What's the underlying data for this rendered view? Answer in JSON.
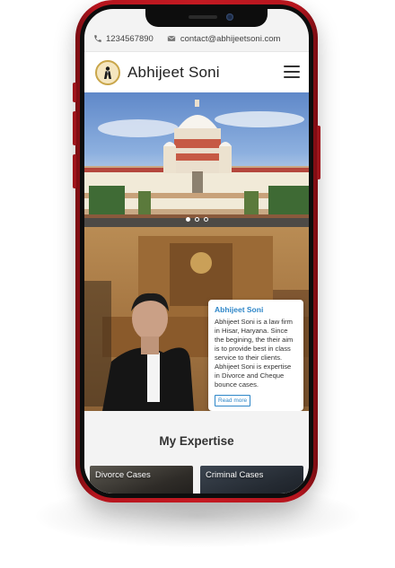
{
  "topbar": {
    "phone_icon": "phone-icon",
    "phone": "1234567890",
    "mail_icon": "envelope-icon",
    "email": "contact@abhijeetsoni.com"
  },
  "header": {
    "logo_icon": "lawyer-logo-icon",
    "brand": "Abhijeet Soni",
    "menu_icon": "hamburger-menu-icon"
  },
  "hero": {
    "slide_count": 3,
    "active_slide": 1
  },
  "about": {
    "title": "Abhijeet Soni",
    "text": "Abhijeet Soni is a law firm in Hisar, Haryana. Since the begining, the their aim is to provide best in class service to their clients. Abhijeet Soni is expertise in Divorce and Cheque bounce cases.",
    "button": "Read more"
  },
  "expertise": {
    "heading": "My Expertise",
    "cards": [
      {
        "label": "Divorce Cases"
      },
      {
        "label": "Criminal Cases"
      }
    ]
  },
  "colors": {
    "phone_frame": "#c41a22",
    "accent": "#2e86c8"
  }
}
